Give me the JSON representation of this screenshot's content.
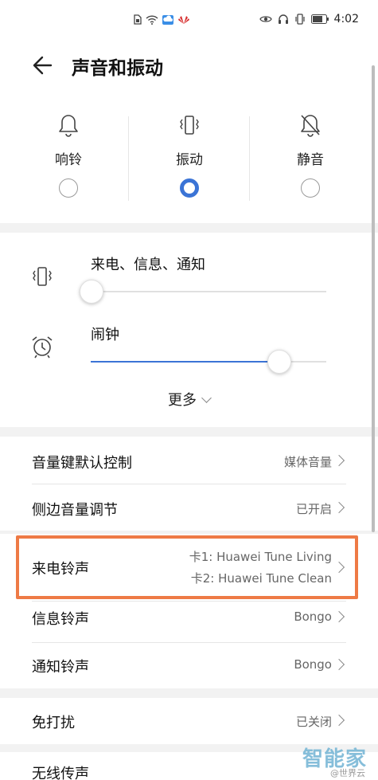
{
  "status_bar": {
    "time": "4:02"
  },
  "header": {
    "title": "声音和振动"
  },
  "modes": [
    {
      "label": "响铃",
      "icon": "bell-icon",
      "selected": false
    },
    {
      "label": "振动",
      "icon": "vibrate-icon",
      "selected": true
    },
    {
      "label": "静音",
      "icon": "bell-off-icon",
      "selected": false
    }
  ],
  "volumes": [
    {
      "label": "来电、信息、通知",
      "icon": "vibrate-icon",
      "level": 0.0
    },
    {
      "label": "闹钟",
      "icon": "alarm-clock-icon",
      "level": 0.8
    }
  ],
  "more_label": "更多",
  "settings": {
    "volume_key_label": "音量键默认控制",
    "volume_key_value": "媒体音量",
    "side_volume_label": "侧边音量调节",
    "side_volume_value": "已开启",
    "ringtone_label": "来电铃声",
    "ringtone_card1": "卡1: Huawei Tune Living",
    "ringtone_card2": "卡2: Huawei Tune Clean",
    "message_label": "信息铃声",
    "message_value": "Bongo",
    "notify_label": "通知铃声",
    "notify_value": "Bongo",
    "dnd_label": "免打扰",
    "dnd_value": "已关闭",
    "wireless_label": "无线传声"
  },
  "watermark": {
    "main": "智能家",
    "sub": "@世界云"
  },
  "colors": {
    "accent": "#3b74d6",
    "highlight": "#ee7a45"
  }
}
